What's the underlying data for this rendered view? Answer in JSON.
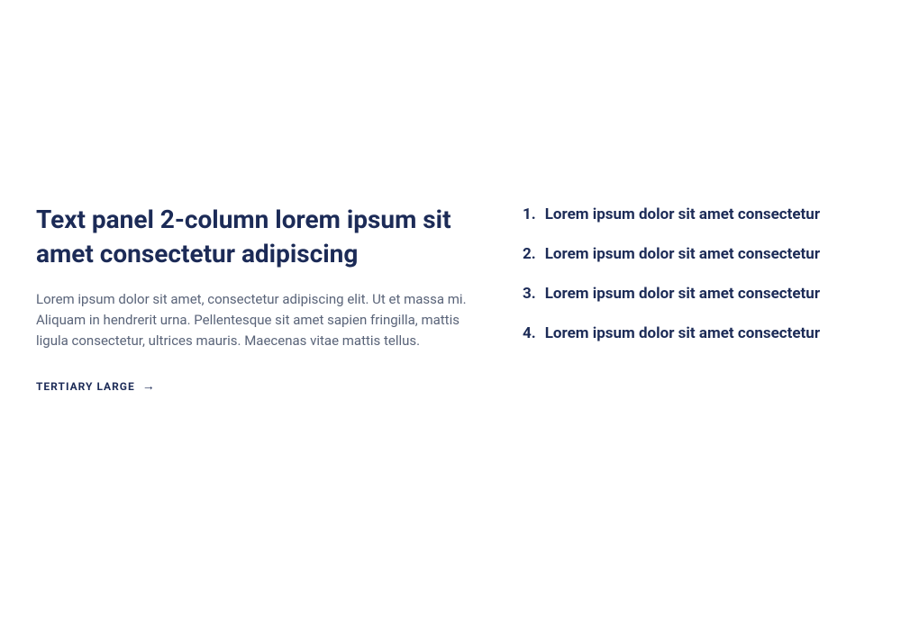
{
  "left": {
    "heading": "Text panel 2-column lorem ipsum sit amet consectetur adipiscing",
    "body": "Lorem ipsum dolor sit amet, consectetur adipiscing elit. Ut et massa mi. Aliquam in hendrerit urna. Pellentesque sit amet sapien fringilla, mattis ligula consectetur, ultrices mauris. Maecenas vitae mattis tellus.",
    "link_label": "TERTIARY LARGE"
  },
  "right": {
    "items": [
      "Lorem ipsum dolor sit amet consectetur",
      "Lorem ipsum dolor sit amet consectetur",
      "Lorem ipsum dolor sit amet consectetur",
      "Lorem ipsum dolor sit amet consectetur"
    ]
  }
}
